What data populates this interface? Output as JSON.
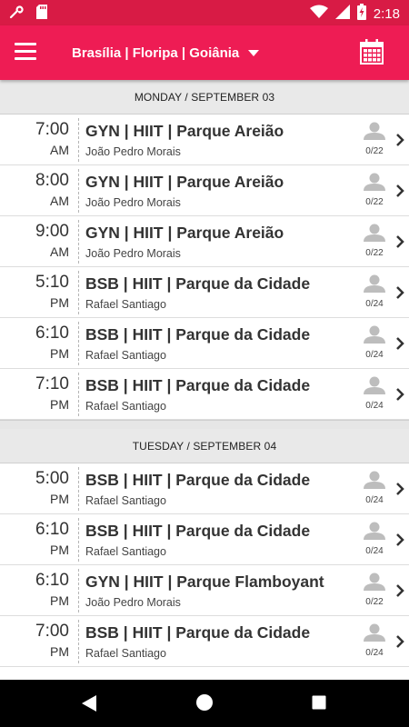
{
  "status_bar": {
    "time": "2:18",
    "icons": [
      "wrench-icon",
      "sd-card-icon",
      "wifi-icon",
      "signal-icon",
      "battery-charging-icon"
    ]
  },
  "app_bar": {
    "menu_icon": "menu-icon",
    "city_selector": "Brasília | Floripa | Goiânia",
    "calendar_icon": "calendar-icon"
  },
  "days": [
    {
      "header": "MONDAY / SEPTEMBER 03",
      "classes": [
        {
          "time": "7:00",
          "ampm": "AM",
          "title": "GYN | HIIT | Parque Areião",
          "coach": "João Pedro Morais",
          "count": "0/22"
        },
        {
          "time": "8:00",
          "ampm": "AM",
          "title": "GYN | HIIT | Parque Areião",
          "coach": "João Pedro Morais",
          "count": "0/22"
        },
        {
          "time": "9:00",
          "ampm": "AM",
          "title": "GYN | HIIT | Parque Areião",
          "coach": "João Pedro Morais",
          "count": "0/22"
        },
        {
          "time": "5:10",
          "ampm": "PM",
          "title": "BSB | HIIT | Parque da Cidade",
          "coach": "Rafael Santiago",
          "count": "0/24"
        },
        {
          "time": "6:10",
          "ampm": "PM",
          "title": "BSB | HIIT | Parque da Cidade",
          "coach": "Rafael Santiago",
          "count": "0/24"
        },
        {
          "time": "7:10",
          "ampm": "PM",
          "title": "BSB | HIIT | Parque da Cidade",
          "coach": "Rafael Santiago",
          "count": "0/24"
        }
      ]
    },
    {
      "header": "TUESDAY / SEPTEMBER 04",
      "classes": [
        {
          "time": "5:00",
          "ampm": "PM",
          "title": "BSB | HIIT | Parque da Cidade",
          "coach": "Rafael Santiago",
          "count": "0/24"
        },
        {
          "time": "6:10",
          "ampm": "PM",
          "title": "BSB | HIIT | Parque da Cidade",
          "coach": "Rafael Santiago",
          "count": "0/24"
        },
        {
          "time": "6:10",
          "ampm": "PM",
          "title": "GYN | HIIT | Parque Flamboyant",
          "coach": "João Pedro Morais",
          "count": "0/22"
        },
        {
          "time": "7:00",
          "ampm": "PM",
          "title": "BSB | HIIT | Parque da Cidade",
          "coach": "Rafael Santiago",
          "count": "0/24"
        }
      ]
    }
  ],
  "colors": {
    "app_bar": "#ee1c54",
    "status_bar": "#d81b45",
    "day_header_bg": "#e9e9e9",
    "row_bg": "#ffffff",
    "text": "#333333"
  },
  "nav_bar": {
    "icons": [
      "back-icon",
      "home-icon",
      "recent-apps-icon"
    ]
  }
}
